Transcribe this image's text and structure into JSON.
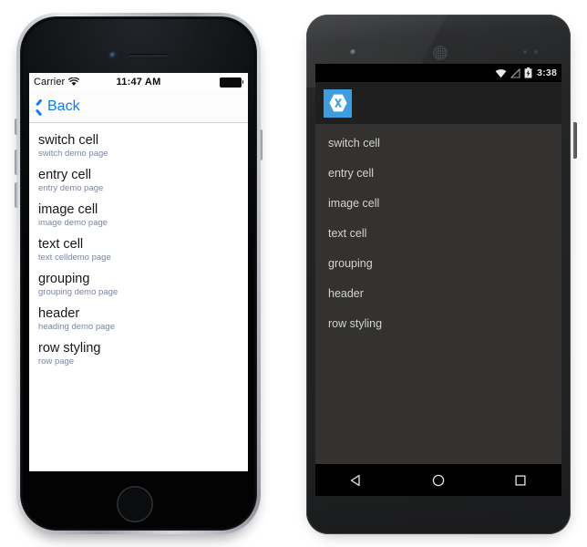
{
  "ios": {
    "status": {
      "carrier": "Carrier",
      "wifi_icon": "wifi-icon",
      "time": "11:47 AM",
      "battery_icon": "battery-full-icon"
    },
    "nav": {
      "back_icon": "chevron-left-icon",
      "back_label": "Back"
    },
    "list": [
      {
        "title": "switch cell",
        "subtitle": "switch demo page"
      },
      {
        "title": "entry cell",
        "subtitle": "entry demo page"
      },
      {
        "title": "image cell",
        "subtitle": "image demo page"
      },
      {
        "title": "text cell",
        "subtitle": "text celldemo page"
      },
      {
        "title": "grouping",
        "subtitle": "grouping demo page"
      },
      {
        "title": "header",
        "subtitle": "heading demo page"
      },
      {
        "title": "row styling",
        "subtitle": "row page"
      }
    ],
    "colors": {
      "accent": "#0a7cff",
      "title": "#17171a",
      "subtitle": "#7c86a0",
      "background": "#ffffff"
    }
  },
  "android": {
    "status": {
      "wifi_icon": "wifi-icon",
      "signal_icon": "signal-no-sim-icon",
      "battery_icon": "battery-charging-icon",
      "clock": "3:38"
    },
    "actionbar": {
      "logo_icon": "xamarin-logo-icon"
    },
    "list": [
      {
        "title": "switch cell"
      },
      {
        "title": "entry cell"
      },
      {
        "title": "image cell"
      },
      {
        "title": "text cell"
      },
      {
        "title": "grouping"
      },
      {
        "title": "header"
      },
      {
        "title": "row styling"
      }
    ],
    "navbar": {
      "back_icon": "nav-back-triangle-icon",
      "home_icon": "nav-home-circle-icon",
      "recents_icon": "nav-recents-square-icon"
    },
    "colors": {
      "accent": "#3d9ddf",
      "text": "#d3d3d3",
      "background": "#333230",
      "actionbar": "#1f1f1f",
      "statusbar": "#000000"
    }
  }
}
